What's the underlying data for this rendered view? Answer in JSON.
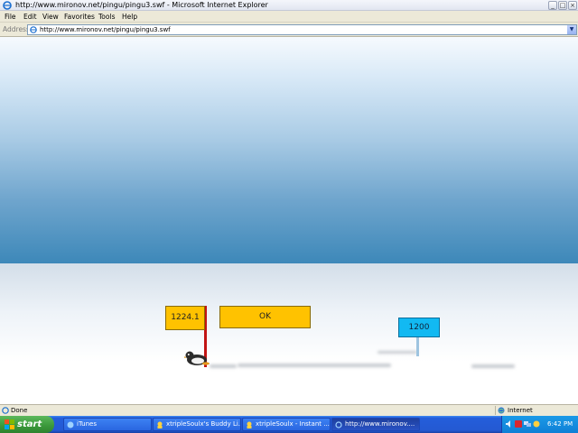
{
  "window": {
    "title": "http://www.mironov.net/pingu/pingu3.swf - Microsoft Internet Explorer"
  },
  "menu": [
    "File",
    "Edit",
    "View",
    "Favorites",
    "Tools",
    "Help"
  ],
  "address": {
    "label": "Address",
    "url": "http://www.mironov.net/pingu/pingu3.swf"
  },
  "game": {
    "distance": "1224.1",
    "ok_label": "OK",
    "record": "1200"
  },
  "status": {
    "text": "Done",
    "zone": "Internet"
  },
  "taskbar": {
    "start_label": "start",
    "tasks": [
      {
        "label": "iTunes",
        "icon": "itunes-icon"
      },
      {
        "label": "xtripleSoulx's Buddy Li...",
        "icon": "buddy-list-icon"
      },
      {
        "label": "xtripleSoulx - Instant ...",
        "icon": "instant-message-icon"
      },
      {
        "label": "http://www.mironov....",
        "icon": "ie-icon",
        "active": true
      }
    ],
    "clock": "6:42 PM"
  },
  "colors": {
    "sign_yellow": "#ffc200",
    "sign_blue": "#12b9f2",
    "pole_red": "#c21414",
    "taskbar_blue": "#245edb",
    "start_green": "#3c9a3c"
  }
}
